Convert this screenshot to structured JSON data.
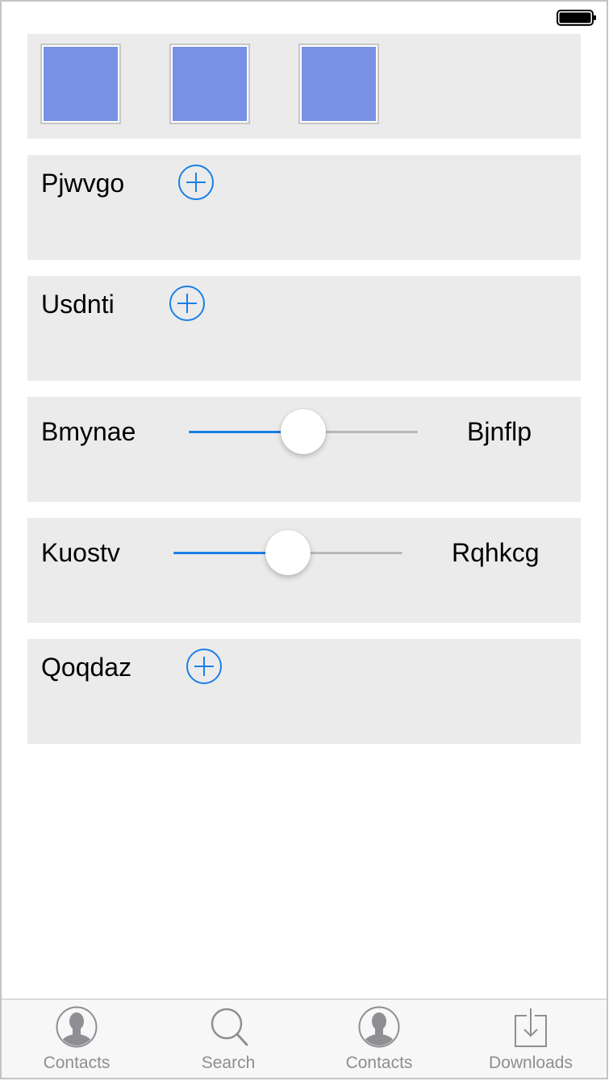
{
  "status_bar": {
    "battery_icon": "battery-icon"
  },
  "image_row": {
    "images": [
      {
        "icon": "image-thumbnail"
      },
      {
        "icon": "image-thumbnail"
      },
      {
        "icon": "image-thumbnail"
      }
    ]
  },
  "rows": [
    {
      "label": "Pjwvgo",
      "action_icon": "plus-circle-icon"
    },
    {
      "label": "Usdnti",
      "action_icon": "plus-circle-icon"
    },
    {
      "label": "Bmynae",
      "slider_value": 0.5,
      "end_label": "Bjnflp"
    },
    {
      "label": "Kuostv",
      "slider_value": 0.5,
      "end_label": "Rqhkcg"
    },
    {
      "label": "Qoqdaz",
      "action_icon": "plus-circle-icon"
    }
  ],
  "tab_bar": {
    "tabs": [
      {
        "label": "Contacts",
        "icon": "contacts-icon"
      },
      {
        "label": "Search",
        "icon": "search-icon"
      },
      {
        "label": "Contacts",
        "icon": "contacts-icon"
      },
      {
        "label": "Downloads",
        "icon": "downloads-icon"
      }
    ]
  },
  "colors": {
    "accent": "#1a7fe8",
    "card_background": "#ebebeb",
    "tab_inactive": "#8e8e93",
    "image_fill": "#7891e4",
    "slider_track": "#b8b8b8"
  }
}
